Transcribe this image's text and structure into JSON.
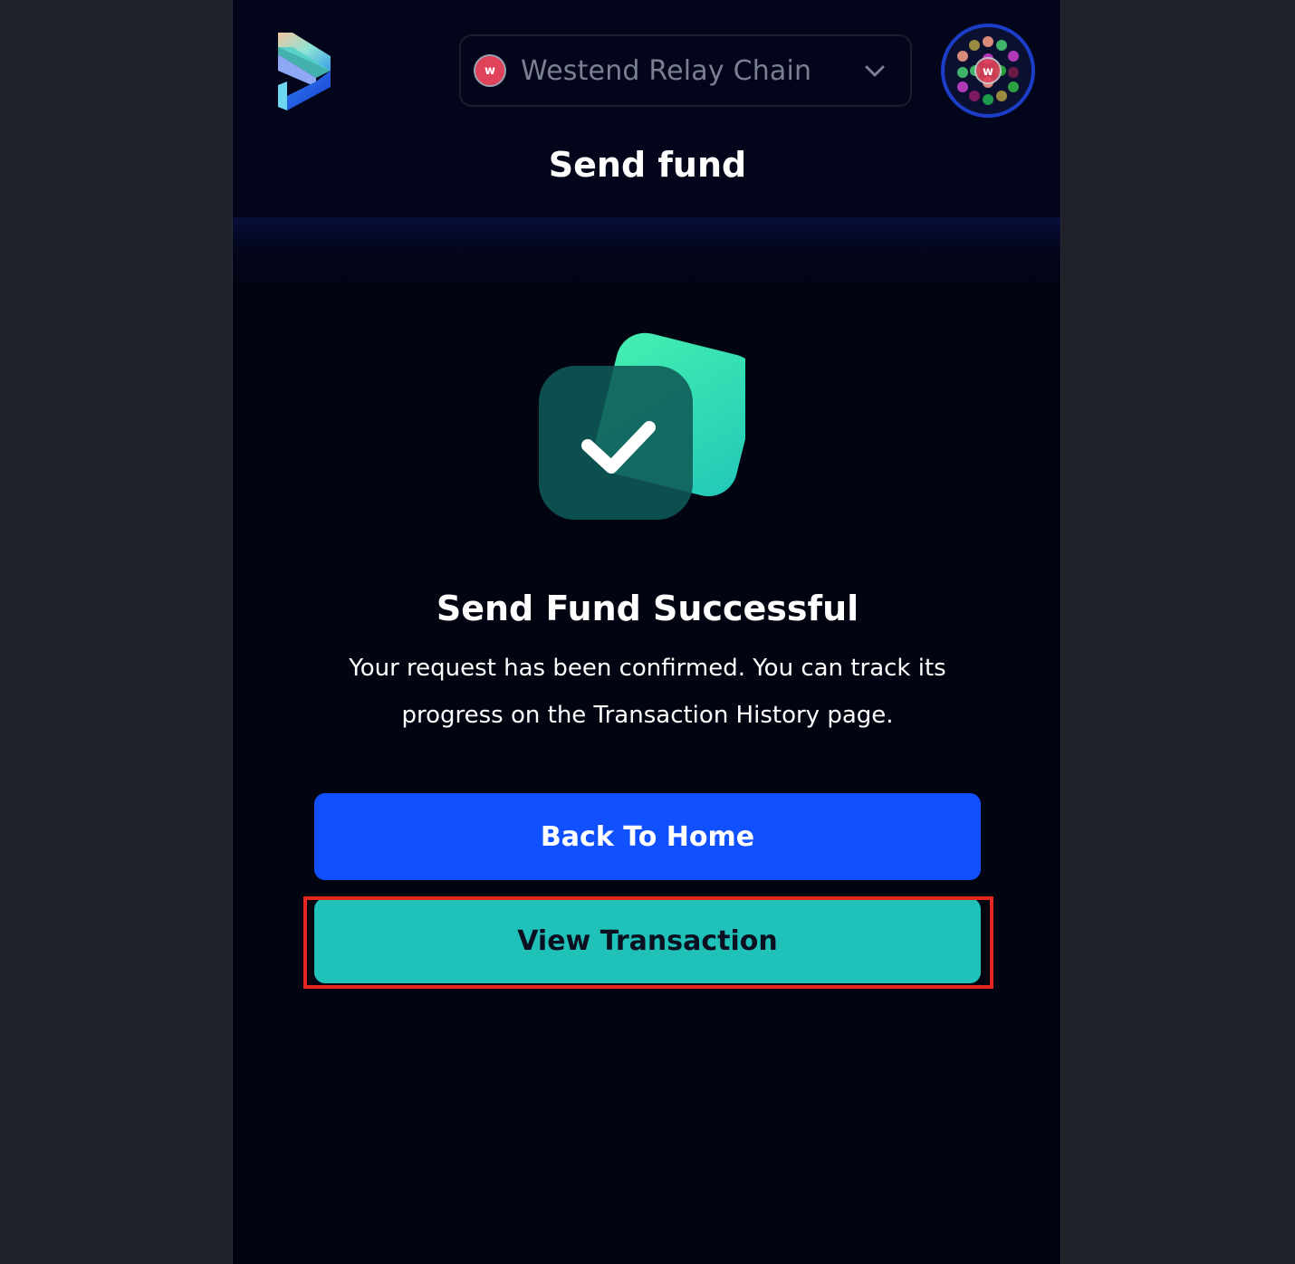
{
  "header": {
    "logo_icon": "subwallet-logo-icon",
    "network": {
      "name": "Westend Relay Chain",
      "logo_letter": "w",
      "icon": "chevron-down-icon"
    },
    "avatar_icon": "account-avatar-icon",
    "title": "Send fund"
  },
  "result": {
    "icon": "success-check-icon",
    "heading": "Send Fund Successful",
    "message": "Your request has been confirmed. You can track its progress on the Transaction History page."
  },
  "actions": {
    "back_home_label": "Back To Home",
    "view_transaction_label": "View Transaction"
  },
  "colors": {
    "primary": "#1150ff",
    "secondary": "#20c1b9",
    "success": "#2fe0b0",
    "highlight": "#e5281f",
    "background": "#020412"
  }
}
